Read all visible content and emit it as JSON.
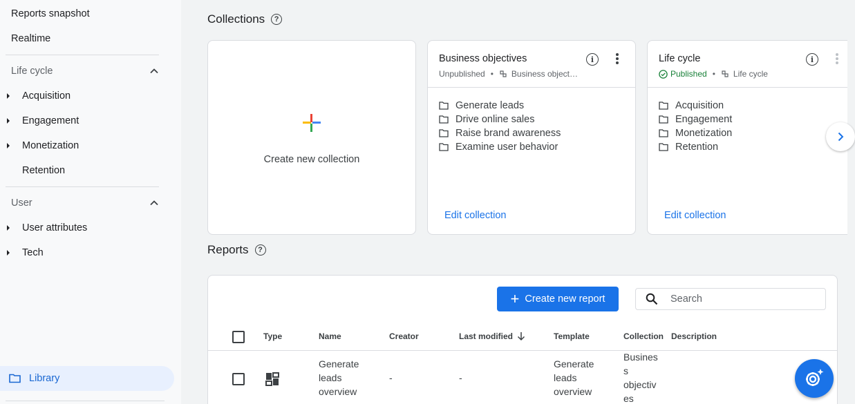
{
  "sidebar": {
    "top_items": [
      "Reports snapshot",
      "Realtime"
    ],
    "sections": [
      {
        "label": "Life cycle",
        "items": [
          "Acquisition",
          "Engagement",
          "Monetization",
          "Retention"
        ]
      },
      {
        "label": "User",
        "items": [
          "User attributes",
          "Tech"
        ]
      }
    ],
    "library_label": "Library"
  },
  "collections": {
    "title": "Collections",
    "create_label": "Create new collection",
    "cards": [
      {
        "title": "Business objectives",
        "status": "Unpublished",
        "template": "Business object…",
        "items": [
          "Generate leads",
          "Drive online sales",
          "Raise brand awareness",
          "Examine user behavior"
        ],
        "edit_label": "Edit collection"
      },
      {
        "title": "Life cycle",
        "status": "Published",
        "template": "Life cycle",
        "items": [
          "Acquisition",
          "Engagement",
          "Monetization",
          "Retention"
        ],
        "edit_label": "Edit collection"
      }
    ]
  },
  "reports": {
    "title": "Reports",
    "create_label": "Create new report",
    "search_placeholder": "Search",
    "columns": [
      "Type",
      "Name",
      "Creator",
      "Last modified",
      "Template",
      "Collection",
      "Description"
    ],
    "rows": [
      {
        "name_lines": [
          "Generate",
          "leads",
          "overview"
        ],
        "creator": "-",
        "last_modified": "-",
        "template_lines": [
          "Generate",
          "leads",
          "overview"
        ],
        "collection_lines": [
          "Busines",
          "s",
          "objectiv",
          "es"
        ]
      }
    ]
  },
  "colors": {
    "accent": "#1a73e8",
    "published": "#188038",
    "selected_bg": "#e8f0fe"
  }
}
